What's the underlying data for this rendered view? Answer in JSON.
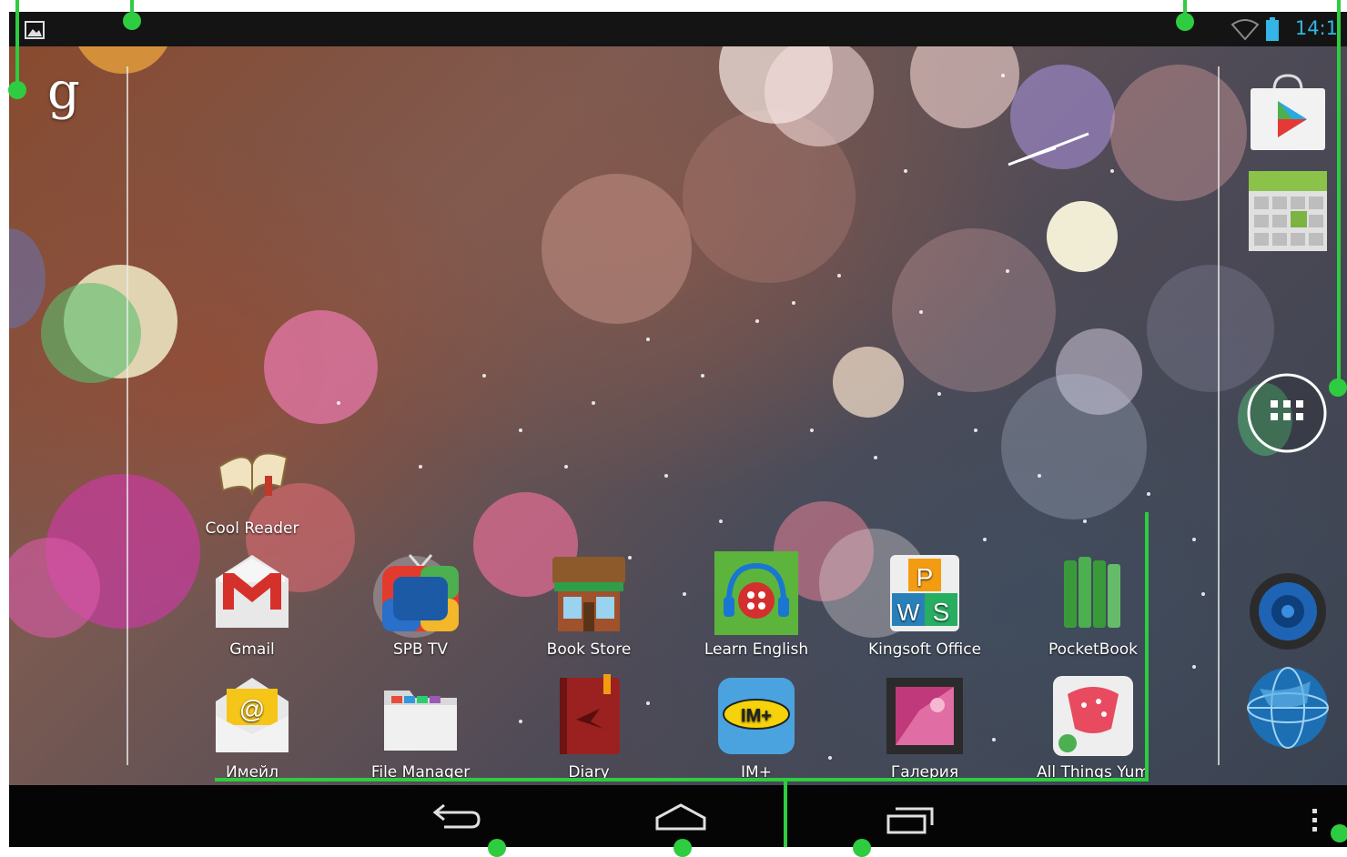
{
  "status_bar": {
    "time": "14:1",
    "icons": [
      "gallery-notification-icon",
      "wifi-icon",
      "battery-icon"
    ]
  },
  "google_search": {
    "glyph": "g"
  },
  "dock": {
    "items": [
      "play-store-icon",
      "calendar-icon",
      "all-apps-icon",
      "music-speaker-icon",
      "browser-globe-icon"
    ]
  },
  "desktop": {
    "cool_reader": "Cool Reader",
    "row1": [
      "Gmail",
      "SPB TV",
      "Book Store",
      "Learn English",
      "Kingsoft Office",
      "PocketBook"
    ],
    "row2": [
      "Имейл",
      "File Manager",
      "Diary",
      "IM+",
      "Галерия",
      "All Things Yum"
    ]
  },
  "nav_bar": {
    "buttons": [
      "back-icon",
      "home-icon",
      "recent-apps-icon",
      "menu-overflow-icon"
    ]
  },
  "colors": {
    "accent": "#33b5e5",
    "annotation": "#2ecc40"
  }
}
